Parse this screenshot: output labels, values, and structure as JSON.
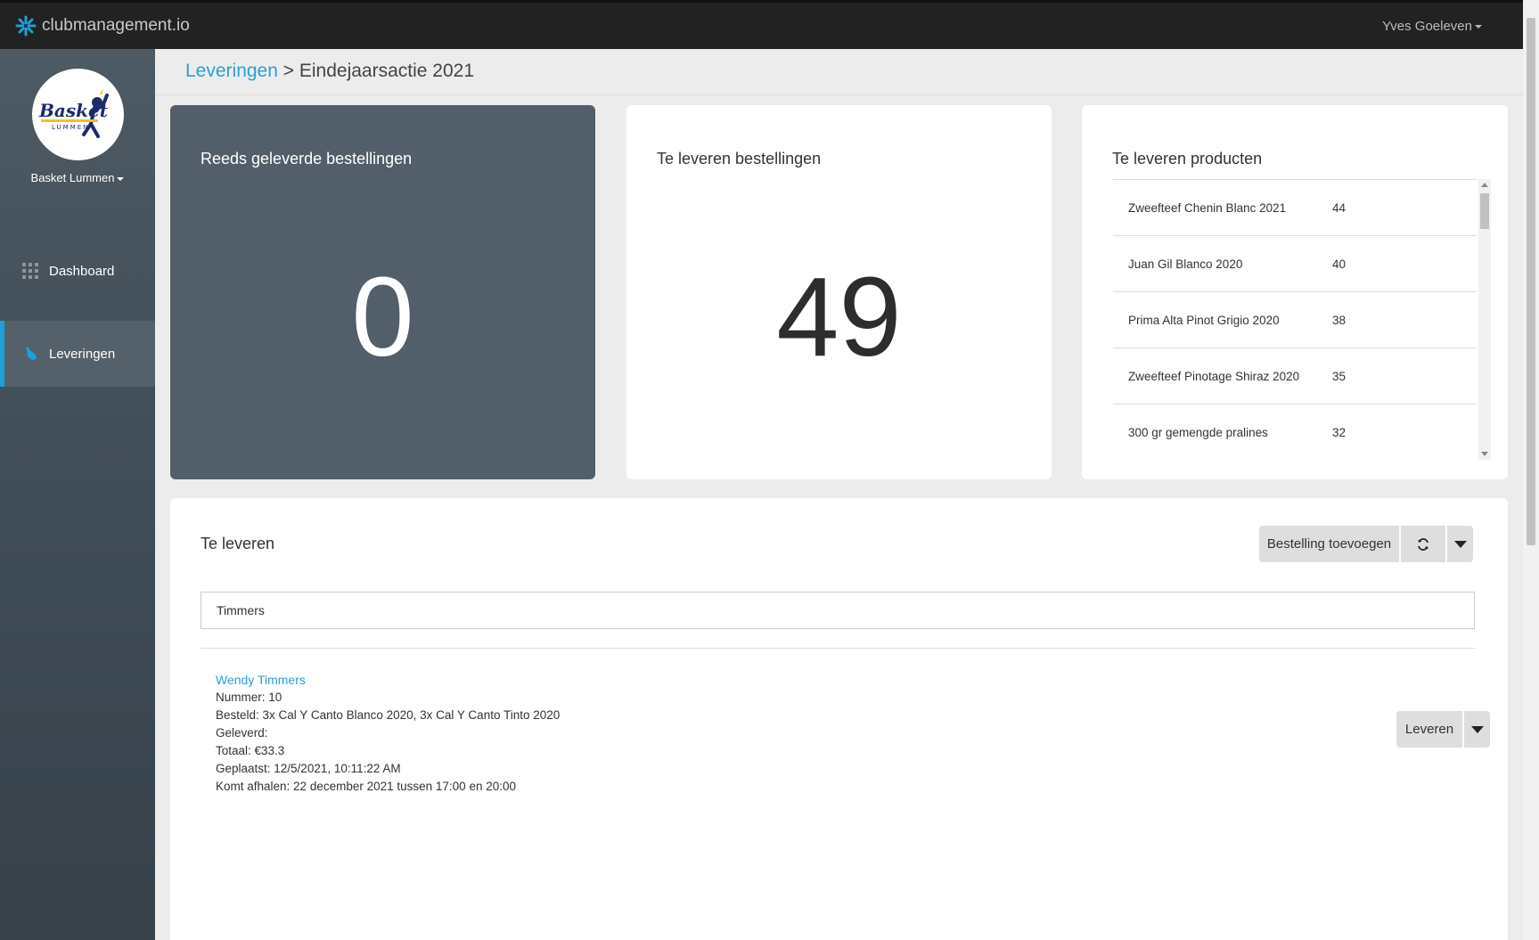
{
  "app": {
    "brand": "clubmanagement.io",
    "user": "Yves Goeleven"
  },
  "sidebar": {
    "club_name": "Basket Lummen",
    "logo_text": {
      "word": "Basket",
      "sub": "LUMMEN"
    },
    "items": [
      {
        "label": "Dashboard",
        "icon": "grid-icon",
        "active": false
      },
      {
        "label": "Leveringen",
        "icon": "bottle-icon",
        "active": true
      }
    ]
  },
  "breadcrumb": {
    "parent": "Leveringen",
    "separator": " > ",
    "current": "Eindejaarsactie 2021"
  },
  "cards": {
    "delivered": {
      "title": "Reeds geleverde bestellingen",
      "value": "0"
    },
    "to_deliver": {
      "title": "Te leveren bestellingen",
      "value": "49"
    },
    "products": {
      "title": "Te leveren producten",
      "rows": [
        {
          "name": "Zweefteef Chenin Blanc 2021",
          "qty": "44"
        },
        {
          "name": "Juan Gil Blanco 2020",
          "qty": "40"
        },
        {
          "name": "Prima Alta Pinot Grigio 2020",
          "qty": "38"
        },
        {
          "name": "Zweefteef Pinotage Shiraz 2020",
          "qty": "35"
        },
        {
          "name": "300 gr gemengde pralines",
          "qty": "32"
        }
      ]
    }
  },
  "panel": {
    "title": "Te leveren",
    "add_button": "Bestelling toevoegen",
    "search_value": "Timmers",
    "orders": [
      {
        "customer": "Wendy Timmers",
        "number": "Nummer: 10",
        "ordered": "Besteld: 3x Cal Y Canto Blanco 2020, 3x Cal Y Canto Tinto 2020",
        "delivered": "Geleverd:",
        "total": "Totaal: €33.3",
        "placed": "Geplaatst: 12/5/2021, 10:11:22 AM",
        "pickup": "Komt afhalen: 22 december 2021 tussen 17:00 en 20:00",
        "action": "Leveren"
      }
    ]
  },
  "colors": {
    "accent": "#2a9fd6",
    "topbar": "#222222",
    "sidebar": "#46525c",
    "dark_card": "#525f6a"
  }
}
